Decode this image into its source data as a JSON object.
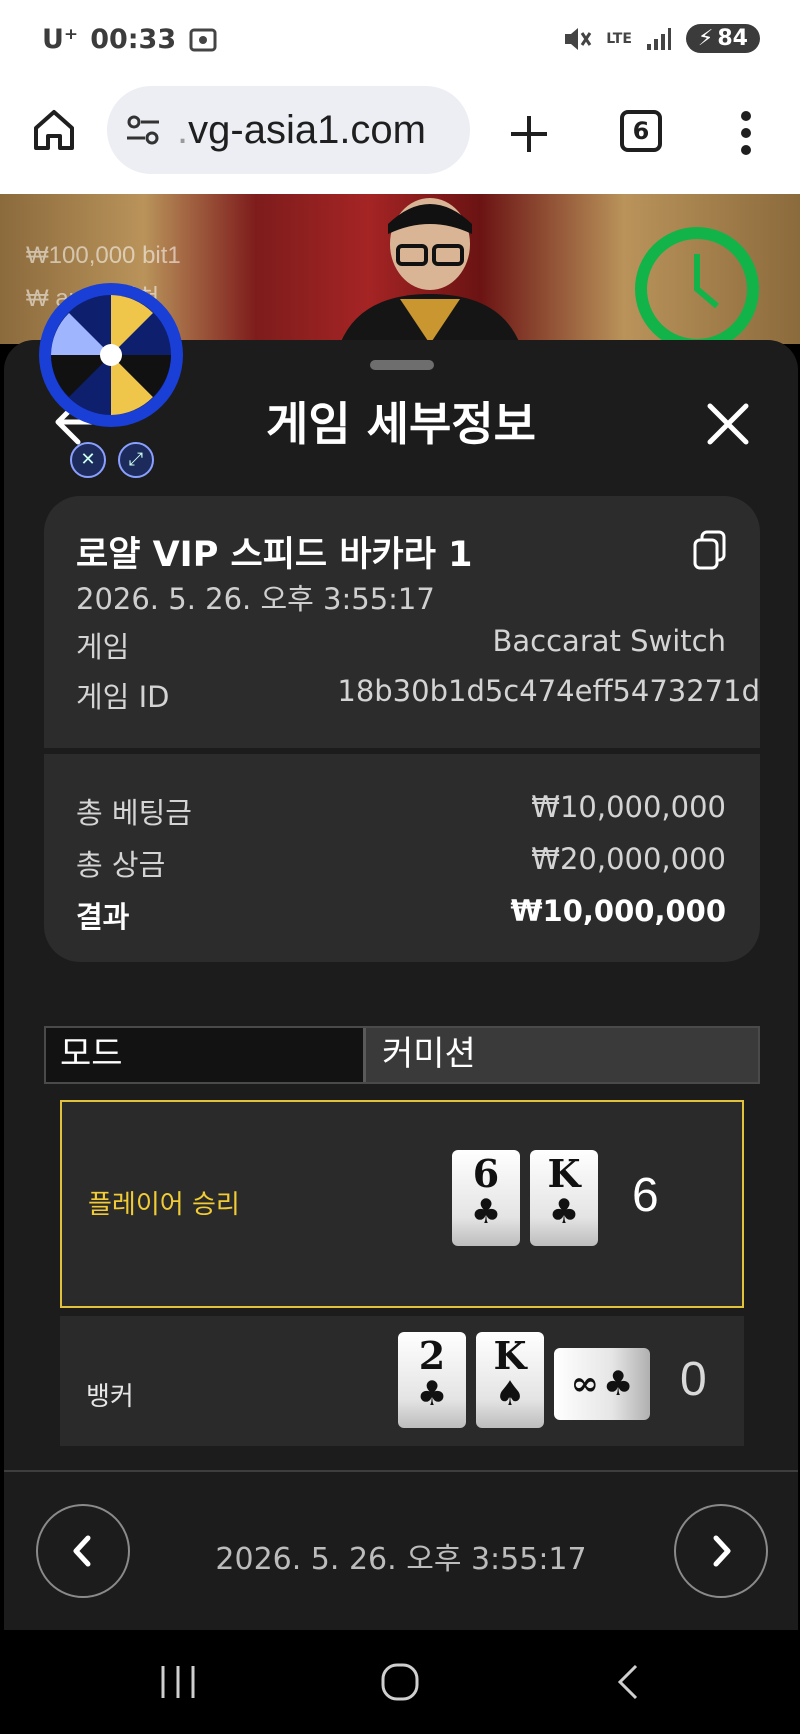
{
  "status": {
    "carrier": "U⁺",
    "time": "00:33",
    "network": "LTE",
    "battery": "84"
  },
  "browser": {
    "url_prefix": ".",
    "url_text": "vg-asia1.com",
    "tab_count": "6"
  },
  "video": {
    "ticker_line1": "₩100,000 bit1",
    "ticker_line2": "₩     am3_외쳐"
  },
  "sheet": {
    "title": "게임 세부정보"
  },
  "game": {
    "name": "로얄 VIP 스피드 바카라 1",
    "datetime": "2026. 5. 26. 오후 3:55:17",
    "game_label": "게임",
    "game_value": "Baccarat Switch",
    "id_label": "게임 ID",
    "id_value": "18b30b1d5c474eff5473271d"
  },
  "totals": {
    "bet_label": "총 베팅금",
    "bet_value": "₩10,000,000",
    "prize_label": "총 상금",
    "prize_value": "₩20,000,000",
    "result_label": "결과",
    "result_value": "₩10,000,000"
  },
  "tabs": {
    "mode": "모드",
    "commission": "커미션"
  },
  "results": {
    "player": {
      "label": "플레이어 승리",
      "cards": [
        {
          "rank": "6",
          "suit": "♣"
        },
        {
          "rank": "K",
          "suit": "♣"
        }
      ],
      "score": "6"
    },
    "banker": {
      "label": "뱅커",
      "cards": [
        {
          "rank": "2",
          "suit": "♣"
        },
        {
          "rank": "K",
          "suit": "♠"
        }
      ],
      "side_card": {
        "rank": "∞",
        "suit": "♣"
      },
      "score": "0"
    }
  },
  "footer": {
    "datetime": "2026. 5. 26. 오후 3:55:17"
  },
  "colors": {
    "accent_gold": "#f1cc35",
    "sheet_bg": "#1c1c1c",
    "card_bg": "#2c2c2c"
  }
}
